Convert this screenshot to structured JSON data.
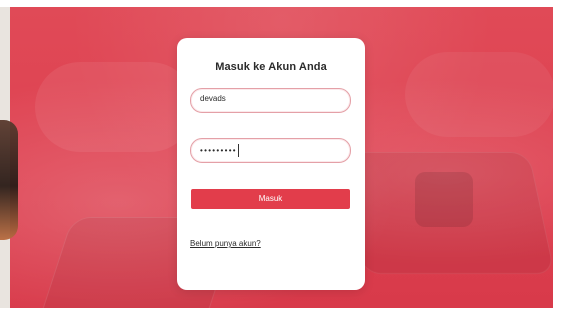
{
  "colors": {
    "hero_red": "#de4050",
    "button_red": "#e23d4b",
    "field_border": "#e4a0a7",
    "text_dark": "#2b2b2b",
    "card_white": "#ffffff"
  },
  "login": {
    "title": "Masuk ke Akun Anda",
    "username": {
      "value": "devads",
      "placeholder": ""
    },
    "password": {
      "value_mask": "•••••••••",
      "placeholder": ""
    },
    "submit_label": "Masuk",
    "register_link_label": "Belum punya akun?"
  }
}
